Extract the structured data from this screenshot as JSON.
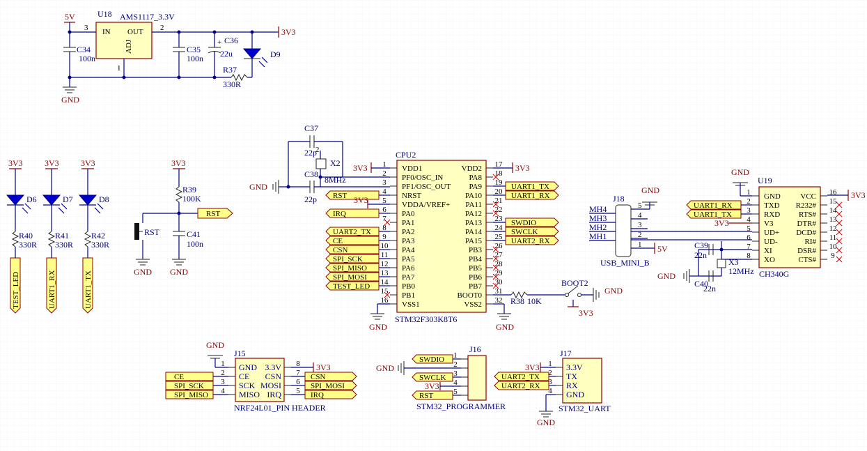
{
  "power": {
    "v5": "5V",
    "v33": "3V3",
    "gnd": "GND"
  },
  "regulator": {
    "ref": "U18",
    "part": "AMS1117_3.3V",
    "in_pin": "IN",
    "out_pin": "OUT",
    "adj_pin": "ADJ",
    "pin3": "3",
    "pin2": "2",
    "pin1": "1"
  },
  "passives": {
    "c34": "C34",
    "c34v": "100n",
    "c35": "C35",
    "c35v": "100n",
    "c36": "C36",
    "c36v": "22u",
    "r37": "R37",
    "r37v": "330R",
    "d9": "D9",
    "c37": "C37",
    "c37v": "22p",
    "c38": "C38",
    "c38v": "22p",
    "x2": "X2",
    "x2v": "8MHz",
    "r39": "R39",
    "r39v": "100K",
    "c41": "C41",
    "c41v": "100n",
    "rst_sw": "RST",
    "r38": "R38",
    "r38v": "10K",
    "boot2": "BOOT2",
    "c39": "C39",
    "c39v": "22n",
    "c40": "C40",
    "c40v": "22n",
    "x3": "X3",
    "x3v": "12MHz",
    "cap_pin2": "2"
  },
  "leds": [
    {
      "d": "D6",
      "r": "R40",
      "rv": "330R",
      "net": "TEST_LED"
    },
    {
      "d": "D7",
      "r": "R41",
      "rv": "330R",
      "net": "UART1_RX"
    },
    {
      "d": "D8",
      "r": "R42",
      "rv": "330R",
      "net": "UART1_TX"
    }
  ],
  "cpu": {
    "ref": "CPU2",
    "part": "STM32F303K8T6",
    "left": [
      {
        "n": "1",
        "name": "VDD1"
      },
      {
        "n": "2",
        "name": "PF0/OSC_IN"
      },
      {
        "n": "3",
        "name": "PF1/OSC_OUT"
      },
      {
        "n": "4",
        "name": "NRST"
      },
      {
        "n": "5",
        "name": "VDDA/VREF+"
      },
      {
        "n": "6",
        "name": "PA0"
      },
      {
        "n": "7",
        "name": "PA1"
      },
      {
        "n": "8",
        "name": "PA2"
      },
      {
        "n": "9",
        "name": "PA3"
      },
      {
        "n": "10",
        "name": "PA4"
      },
      {
        "n": "11",
        "name": "PA5"
      },
      {
        "n": "12",
        "name": "PA6"
      },
      {
        "n": "13",
        "name": "PA7"
      },
      {
        "n": "14",
        "name": "PB0"
      },
      {
        "n": "15",
        "name": "PB1"
      },
      {
        "n": "16",
        "name": "VSS1"
      }
    ],
    "right": [
      {
        "n": "17",
        "name": "VDD2"
      },
      {
        "n": "18",
        "name": "PA8"
      },
      {
        "n": "19",
        "name": "PA9"
      },
      {
        "n": "20",
        "name": "PA10"
      },
      {
        "n": "21",
        "name": "PA11"
      },
      {
        "n": "22",
        "name": "PA12"
      },
      {
        "n": "23",
        "name": "PA13"
      },
      {
        "n": "24",
        "name": "PA14"
      },
      {
        "n": "25",
        "name": "PA15"
      },
      {
        "n": "26",
        "name": "PB3"
      },
      {
        "n": "27",
        "name": "PB4"
      },
      {
        "n": "28",
        "name": "PB5"
      },
      {
        "n": "29",
        "name": "PB6"
      },
      {
        "n": "30",
        "name": "PB7"
      },
      {
        "n": "31",
        "name": "BOOT0"
      },
      {
        "n": "32",
        "name": "VSS2"
      }
    ],
    "left_nets": {
      "4": "RST",
      "5": "3V3",
      "6": "IRQ",
      "8": "UART2_TX",
      "9": "CE",
      "10": "CSN",
      "11": "SPI_SCK",
      "12": "SPI_MISO",
      "13": "SPI_MOSI",
      "14": "TEST_LED"
    },
    "right_nets": {
      "19": "UART1_TX",
      "20": "UART1_RX",
      "23": "SWDIO",
      "24": "SWCLK",
      "25": "UART2_RX"
    }
  },
  "usb": {
    "ref": "J18",
    "part": "USB_MINI_B",
    "mh": [
      "MH4",
      "MH3",
      "MH2",
      "MH1"
    ],
    "pins": [
      "5",
      "4",
      "3",
      "2",
      "1"
    ]
  },
  "ch340": {
    "ref": "U19",
    "part": "CH340G",
    "left": [
      {
        "n": "1",
        "name": "GND"
      },
      {
        "n": "2",
        "name": "TXD"
      },
      {
        "n": "3",
        "name": "RXD"
      },
      {
        "n": "4",
        "name": "V3"
      },
      {
        "n": "5",
        "name": "UD+"
      },
      {
        "n": "6",
        "name": "UD-"
      },
      {
        "n": "7",
        "name": "XI"
      },
      {
        "n": "8",
        "name": "XO"
      }
    ],
    "right": [
      {
        "n": "16",
        "name": "VCC"
      },
      {
        "n": "15",
        "name": "R232#"
      },
      {
        "n": "14",
        "name": "RTS#"
      },
      {
        "n": "13",
        "name": "DTR#"
      },
      {
        "n": "12",
        "name": "DCD#"
      },
      {
        "n": "11",
        "name": "RI#"
      },
      {
        "n": "10",
        "name": "DSR#"
      },
      {
        "n": "9",
        "name": "CTS#"
      }
    ],
    "net_tx": "UART1_RX",
    "net_rx": "UART1_TX"
  },
  "nrf": {
    "ref": "J15",
    "part": "NRF24L01_PIN HEADER",
    "rows": [
      {
        "ln": "1",
        "l": "GND",
        "r": "3.3V",
        "rn": "8"
      },
      {
        "ln": "2",
        "l": "CE",
        "r": "CSN",
        "rn": "7"
      },
      {
        "ln": "3",
        "l": "SCK",
        "r": "MOSI",
        "rn": "6"
      },
      {
        "ln": "4",
        "l": "MISO",
        "r": "IRQ",
        "rn": "5"
      }
    ],
    "nets_l": [
      "CE",
      "SPI_SCK",
      "SPI_MISO"
    ],
    "nets_r": [
      "CSN",
      "SPI_MOSI",
      "IRQ"
    ]
  },
  "prog": {
    "ref": "J16",
    "part": "STM32_PROGRAMMER",
    "pins": [
      "1",
      "2",
      "3",
      "4",
      "5"
    ],
    "nets": [
      "SWDIO",
      "SWCLK",
      "3V3",
      "RST"
    ]
  },
  "uart": {
    "ref": "J17",
    "part": "STM32_UART",
    "pins": [
      "1",
      "2",
      "3",
      "4"
    ],
    "names": [
      "3.3V",
      "TX",
      "RX",
      "GND"
    ],
    "nets": [
      "3V3",
      "UART2_TX",
      "UART2_RX"
    ]
  }
}
